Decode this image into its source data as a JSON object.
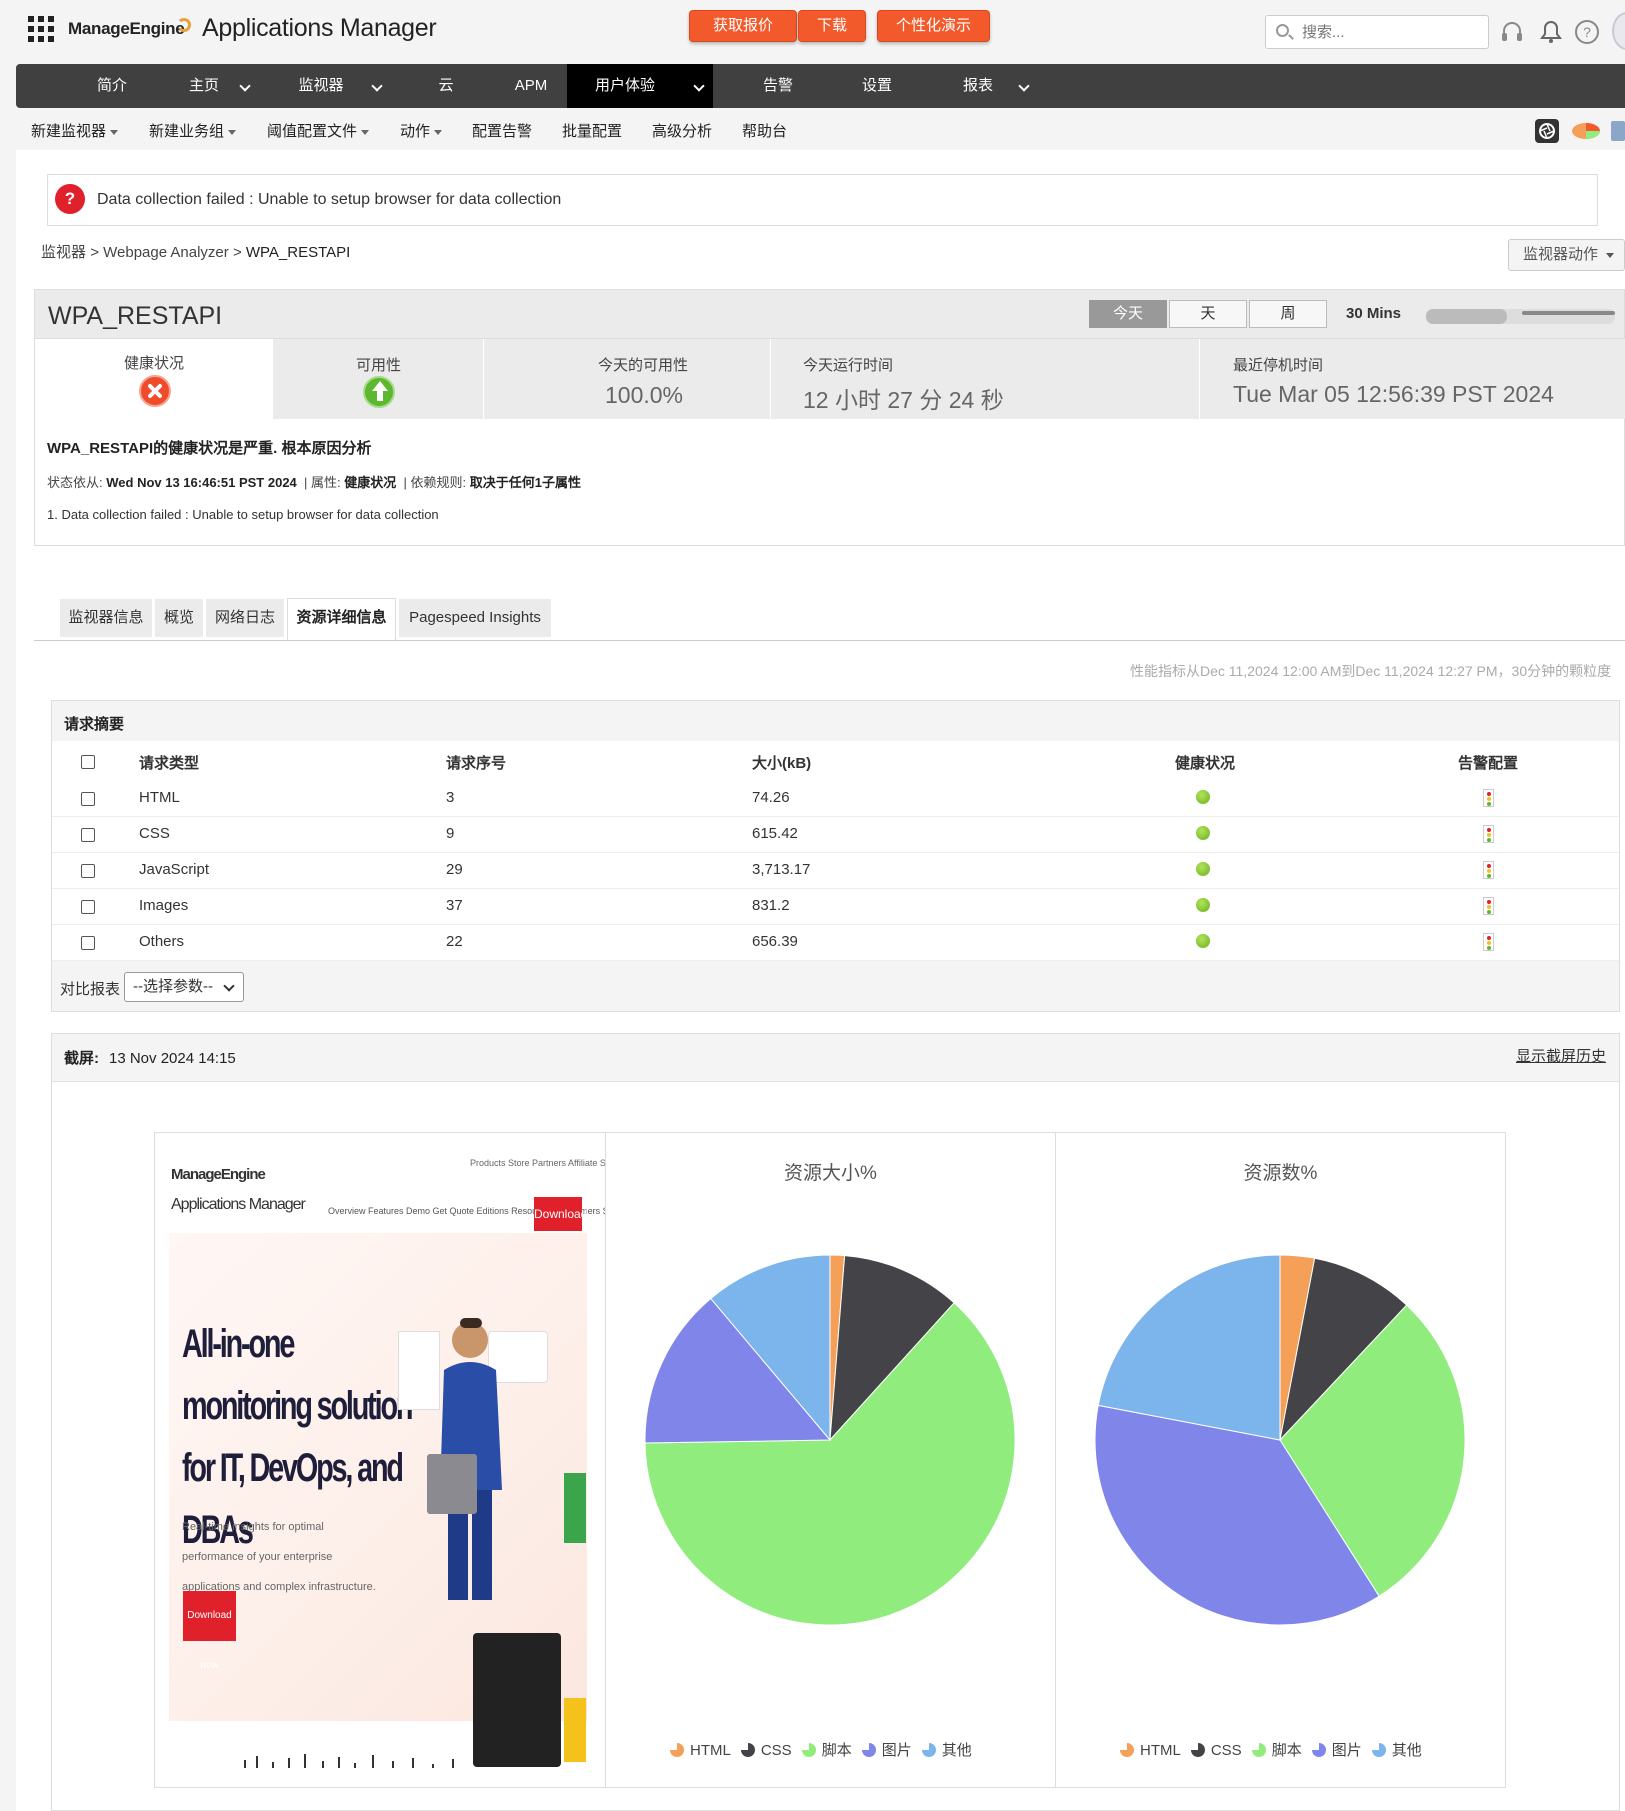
{
  "header": {
    "brand": "ManageEngine",
    "product": "Applications Manager",
    "buttons": [
      "获取报价",
      "下载",
      "个性化演示"
    ],
    "search_placeholder": "搜索..."
  },
  "nav": [
    {
      "label": "简介",
      "caret": false
    },
    {
      "label": "主页",
      "caret": true
    },
    {
      "label": "监视器",
      "caret": true
    },
    {
      "label": "云",
      "caret": false
    },
    {
      "label": "APM",
      "caret": false
    },
    {
      "label": "用户体验",
      "caret": true,
      "active": true
    },
    {
      "label": "告警",
      "caret": false
    },
    {
      "label": "设置",
      "caret": false
    },
    {
      "label": "报表",
      "caret": true
    }
  ],
  "subnav": [
    {
      "label": "新建监视器",
      "dd": true
    },
    {
      "label": "新建业务组",
      "dd": true
    },
    {
      "label": "阈值配置文件",
      "dd": true
    },
    {
      "label": "动作",
      "dd": true
    },
    {
      "label": "配置告警",
      "dd": false
    },
    {
      "label": "批量配置",
      "dd": false
    },
    {
      "label": "高级分析",
      "dd": false
    },
    {
      "label": "帮助台",
      "dd": false
    }
  ],
  "alert": {
    "icon": "?",
    "message": "Data collection failed : Unable to setup browser for data collection"
  },
  "breadcrumb": {
    "root": "监视器",
    "sep": ">",
    "mid": "Webpage Analyzer",
    "current": "WPA_RESTAPI"
  },
  "monitor_actions": "监视器动作",
  "monitor": {
    "name": "WPA_RESTAPI",
    "ranges": [
      "今天",
      "天",
      "周"
    ],
    "active_range": "今天",
    "interval": "30 Mins",
    "slider_level": 0.43
  },
  "stats": {
    "health_label": "健康状况",
    "availability_label": "可用性",
    "today_avail_label": "今天的可用性",
    "today_avail_value": "100.0%",
    "uptime_label": "今天运行时间",
    "uptime_value": "12 小时 27 分 24 秒",
    "last_down_label": "最近停机时间",
    "last_down_value": "Tue Mar 05 12:56:39 PST 2024"
  },
  "rca": {
    "title": "WPA_RESTAPI的健康状况是严重. 根本原因分析",
    "status_label": "状态依从:",
    "status_time": "Wed Nov 13 16:46:51 PST 2024",
    "attr_label": "属性:",
    "attr_value": "健康状况",
    "rule_label": "依赖规则:",
    "rule_value": "取决于任何1子属性",
    "message": "1. Data collection failed : Unable to setup browser for data collection"
  },
  "tabs": [
    "监视器信息",
    "概览",
    "网络日志",
    "资源详细信息",
    "Pagespeed Insights"
  ],
  "active_tab": "资源详细信息",
  "perf_note": "性能指标从Dec 11,2024 12:00 AM到Dec 11,2024 12:27 PM，30分钟的颗粒度",
  "summary": {
    "title": "请求摘要",
    "headers": [
      "请求类型",
      "请求序号",
      "大小(kB)",
      "健康状况",
      "告警配置"
    ],
    "rows": [
      {
        "type": "HTML",
        "count": "3",
        "size": "74.26"
      },
      {
        "type": "CSS",
        "count": "9",
        "size": "615.42"
      },
      {
        "type": "JavaScript",
        "count": "29",
        "size": "3,713.17"
      },
      {
        "type": "Images",
        "count": "37",
        "size": "831.2"
      },
      {
        "type": "Others",
        "count": "22",
        "size": "656.39"
      }
    ],
    "compare_label": "对比报表",
    "compare_select": "--选择参数--"
  },
  "screenshot": {
    "label": "截屏:",
    "time": "13 Nov 2024 14:15",
    "history_link": "显示截屏历史",
    "thumb": {
      "logo1": "ManageEngine",
      "logo2": "Applications Manager",
      "topnav": "Products  Store  Partners  Affiliate  Support",
      "nav": "Overview  Features  Demo  Get Quote  Editions  Resources  Customers  Support",
      "download": "Download",
      "headline": "All-in-one monitoring solution for IT, DevOps, and DBAs",
      "sub": "Real-time insights for optimal performance of your enterprise applications and complex infrastructure.",
      "button": "Download now"
    }
  },
  "colors": {
    "html": "#f4a058",
    "css": "#434348",
    "script": "#90ed7d",
    "images": "#8085e9",
    "others": "#7cb5ec",
    "accent": "#f25a2b"
  },
  "chart_data": [
    {
      "type": "pie",
      "title": "资源大小%",
      "categories": [
        "HTML",
        "CSS",
        "脚本",
        "图片",
        "其他"
      ],
      "values": [
        74.26,
        615.42,
        3713.17,
        831.2,
        656.39
      ]
    },
    {
      "type": "pie",
      "title": "资源数%",
      "categories": [
        "HTML",
        "CSS",
        "脚本",
        "图片",
        "其他"
      ],
      "values": [
        3,
        9,
        29,
        37,
        22
      ]
    }
  ]
}
